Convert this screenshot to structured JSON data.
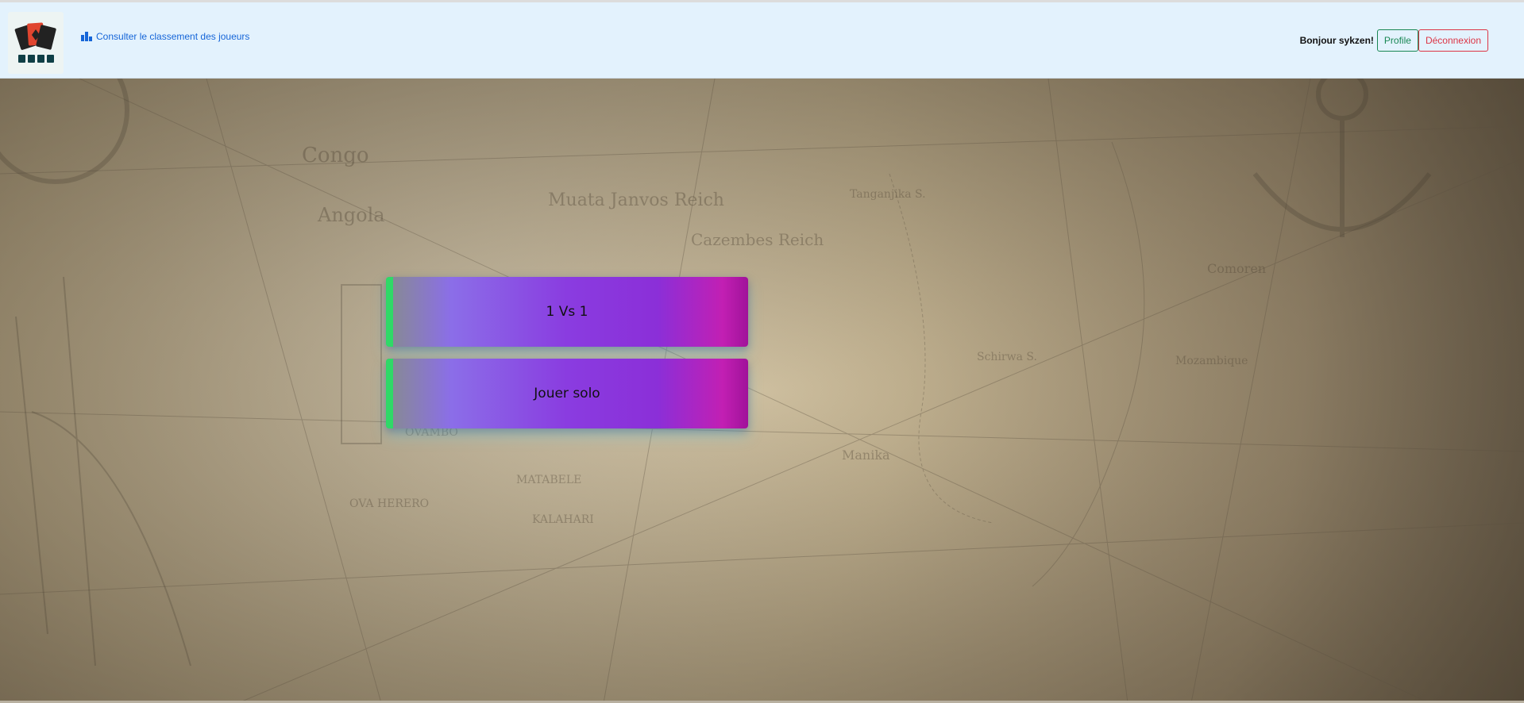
{
  "navbar": {
    "logo_icon": "playing-cards-logo",
    "ranking_link_label": "Consulter le classement des joueurs",
    "ranking_icon": "podium-icon",
    "greeting": "Bonjour sykzen!",
    "profile_label": "Profile",
    "logout_label": "Déconnexion"
  },
  "main": {
    "background": "vintage-map",
    "buttons": {
      "versus_label": "1 Vs 1",
      "solo_label": "Jouer solo"
    }
  },
  "colors": {
    "navbar_bg": "#e3f2fd",
    "link": "#1565d8",
    "profile": "#198754",
    "logout": "#dc3545",
    "button_accent": "#2fd967"
  }
}
